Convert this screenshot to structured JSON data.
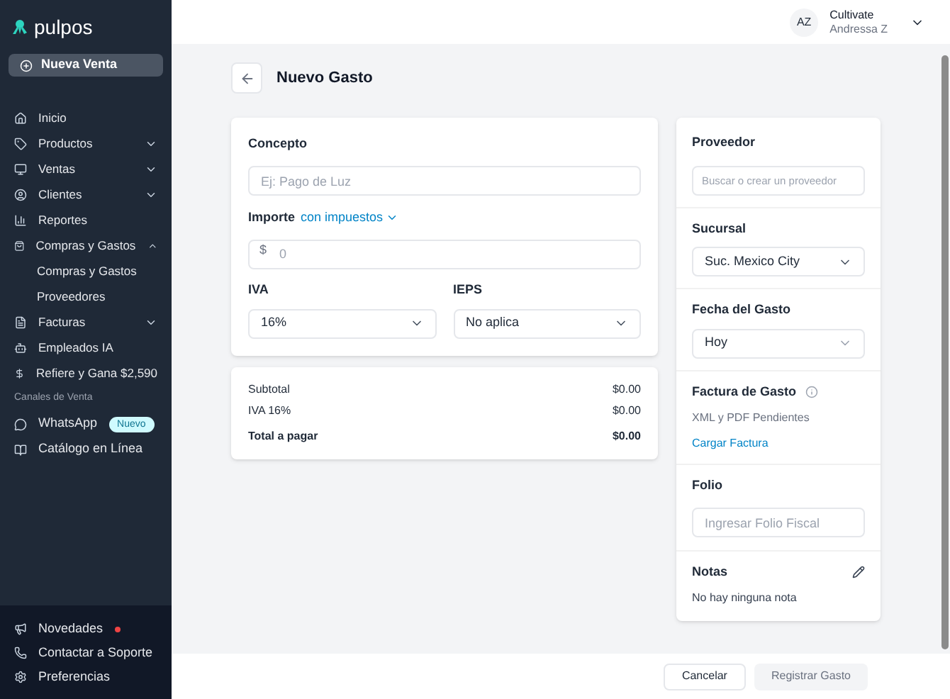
{
  "sidebar": {
    "logo": "pulpos",
    "new_sale_button": "Nueva Venta",
    "nav": [
      {
        "label": "Inicio"
      },
      {
        "label": "Productos",
        "expanded": false
      },
      {
        "label": "Ventas",
        "expanded": false
      },
      {
        "label": "Clientes",
        "expanded": false
      },
      {
        "label": "Reportes"
      },
      {
        "label": "Compras y Gastos",
        "expanded": true,
        "children": [
          {
            "label": "Compras y Gastos"
          },
          {
            "label": "Proveedores"
          }
        ]
      },
      {
        "label": "Facturas",
        "expanded": false
      },
      {
        "label": "Empleados IA"
      },
      {
        "label": "Refiere y Gana $2,590"
      }
    ],
    "section_label": "Canales de Venta",
    "channels": [
      {
        "label": "WhatsApp",
        "badge": "Nuevo"
      },
      {
        "label": "Catálogo en Línea"
      }
    ],
    "footer": [
      {
        "label": "Novedades",
        "dot": true
      },
      {
        "label": "Contactar a Soporte",
        "dot": false
      },
      {
        "label": "Preferencias",
        "dot": false
      }
    ]
  },
  "header": {
    "avatar": "AZ",
    "company": "Cultivate",
    "user": "Andressa Z"
  },
  "page_title": "Nuevo Gasto",
  "form": {
    "concepto": {
      "label": "Concepto",
      "placeholder": "Ej: Pago de Luz"
    },
    "importe": {
      "label": "Importe",
      "mode_link": "con impuestos",
      "currency": "$",
      "placeholder": "0"
    },
    "iva": {
      "label": "IVA",
      "value": "16%"
    },
    "ieps": {
      "label": "IEPS",
      "value": "No aplica"
    }
  },
  "summary": [
    {
      "label": "Subtotal",
      "value": "$0.00",
      "bold": false
    },
    {
      "label": "IVA 16%",
      "value": "$0.00",
      "bold": false
    },
    {
      "label": "Total a pagar",
      "value": "$0.00",
      "bold": true
    }
  ],
  "side_panel": {
    "proveedor": {
      "label": "Proveedor",
      "placeholder": "Buscar o crear un proveedor"
    },
    "sucursal": {
      "label": "Sucursal",
      "value": "Suc. Mexico City"
    },
    "fecha": {
      "label": "Fecha del Gasto",
      "value": "Hoy"
    },
    "factura": {
      "label": "Factura de Gasto",
      "status": "XML y PDF Pendientes",
      "link": "Cargar Factura"
    },
    "folio": {
      "label": "Folio",
      "placeholder": "Ingresar Folio Fiscal"
    },
    "notas": {
      "label": "Notas",
      "empty_text": "No hay ninguna nota"
    }
  },
  "footer_buttons": [
    {
      "label": "Cancelar",
      "disabled": false
    },
    {
      "label": "Registrar Gasto",
      "disabled": true
    }
  ]
}
